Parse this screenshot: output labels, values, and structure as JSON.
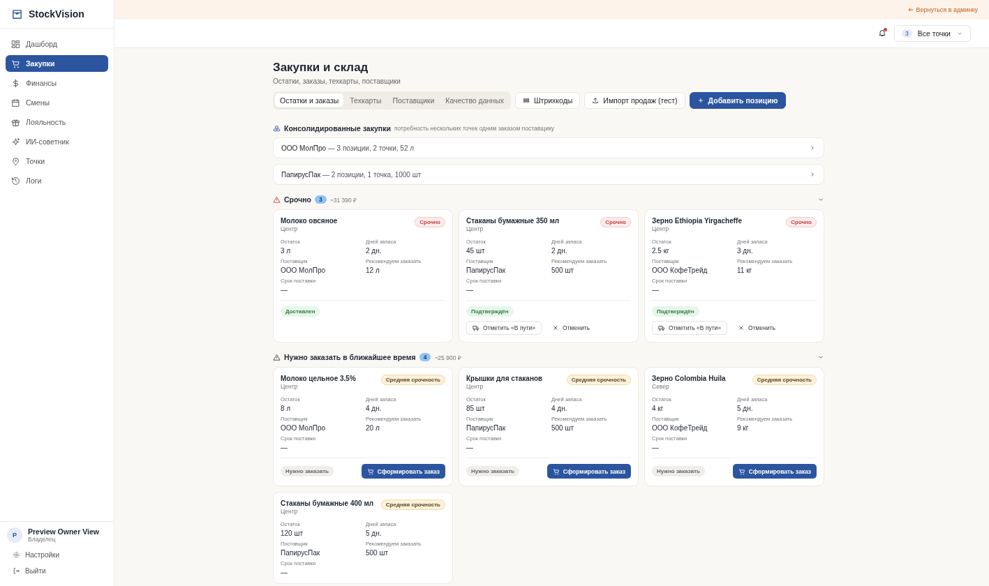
{
  "sidebar": {
    "brand": "StockVision",
    "items": [
      {
        "label": "Дашборд",
        "selected": false
      },
      {
        "label": "Закупки",
        "selected": true
      },
      {
        "label": "Финансы",
        "selected": false
      },
      {
        "label": "Смены",
        "selected": false
      },
      {
        "label": "Лояльность",
        "selected": false
      },
      {
        "label": "ИИ-советник",
        "selected": false
      },
      {
        "label": "Точки",
        "selected": false
      },
      {
        "label": "Логи",
        "selected": false
      }
    ],
    "user": {
      "initial": "P",
      "name": "Preview Owner View",
      "role": "Владелец"
    },
    "footer_links": [
      "Настройки",
      "Выйти"
    ]
  },
  "banner": {
    "link": "Вернуться в админку"
  },
  "header": {
    "notifications_unread": true,
    "location_count": "3",
    "location_label": "Все точки"
  },
  "page": {
    "title": "Закупки и склад",
    "subtitle": "Остатки, заказы, техкарты, поставщики",
    "tabs": [
      {
        "label": "Остатки и заказы",
        "selected": true
      },
      {
        "label": "Техкарты",
        "selected": false
      },
      {
        "label": "Поставщики",
        "selected": false
      },
      {
        "label": "Качество данных",
        "selected": false
      }
    ],
    "buttons": [
      {
        "label": "Штрихкоды",
        "kind": "barcode"
      },
      {
        "label": "Импорт продаж (тест)",
        "kind": "upload"
      },
      {
        "label": "Добавить позицию",
        "kind": "add"
      }
    ]
  },
  "consolidated": {
    "title": "Консолидированные закупки",
    "hint": "потребность нескольких точек одним заказом поставщику",
    "rows": [
      {
        "supplier": "ООО МолПро",
        "details": "— 3 позиции, 2 точки, 52 л"
      },
      {
        "supplier": "ПапирусПак",
        "details": "— 2 позиции, 1 точка, 1000 шт"
      }
    ]
  },
  "sections": [
    {
      "kind": "urgent",
      "title": "Срочно",
      "count": "3",
      "total": "~31 390 ₽",
      "expanded": true,
      "cards": [
        {
          "name": "Молоко овсяное",
          "location": "Центр",
          "badge": {
            "text": "Срочно",
            "kind": "urgent"
          },
          "fields": [
            {
              "label": "Остаток",
              "value": "3 л"
            },
            {
              "label": "Дней запаса",
              "value": "2 дн."
            },
            {
              "label": "Поставщик",
              "value": "ООО МолПро"
            },
            {
              "label": "Рекомендуем заказать",
              "value": "12 л"
            },
            {
              "label": "Срок поставки",
              "value": "—"
            }
          ],
          "status": {
            "text": "Доставлен",
            "kind": "done"
          }
        },
        {
          "name": "Стаканы бумажные 350 мл",
          "location": "Центр",
          "badge": {
            "text": "Срочно",
            "kind": "urgent"
          },
          "fields": [
            {
              "label": "Остаток",
              "value": "45 шт"
            },
            {
              "label": "Дней запаса",
              "value": "2 дн."
            },
            {
              "label": "Поставщик",
              "value": "ПапирусПак"
            },
            {
              "label": "Рекомендуем заказать",
              "value": "500 шт"
            },
            {
              "label": "Срок поставки",
              "value": "—"
            }
          ],
          "status": {
            "text": "Подтверждён",
            "kind": "done"
          },
          "actions": [
            {
              "label": "Отметить «В пути»",
              "kind": "ship"
            },
            {
              "label": "Отменить",
              "kind": "cancel"
            }
          ]
        },
        {
          "name": "Зерно Ethiopia Yirgacheffe",
          "location": "Центр",
          "badge": {
            "text": "Срочно",
            "kind": "urgent"
          },
          "fields": [
            {
              "label": "Остаток",
              "value": "2.5 кг"
            },
            {
              "label": "Дней запаса",
              "value": "3 дн."
            },
            {
              "label": "Поставщик",
              "value": "ООО КофеТрейд"
            },
            {
              "label": "Рекомендуем заказать",
              "value": "11 кг"
            },
            {
              "label": "Срок поставки",
              "value": "—"
            }
          ],
          "status": {
            "text": "Подтверждён",
            "kind": "done"
          },
          "actions": [
            {
              "label": "Отметить «В пути»",
              "kind": "ship"
            },
            {
              "label": "Отменить",
              "kind": "cancel"
            }
          ]
        }
      ]
    },
    {
      "kind": "soon",
      "title": "Нужно заказать в ближайшее время",
      "count": "4",
      "total": "~25 900 ₽",
      "expanded": true,
      "cards": [
        {
          "name": "Молоко цельное 3.5%",
          "location": "Центр",
          "badge": {
            "text": "Средняя срочность",
            "kind": "medium"
          },
          "fields": [
            {
              "label": "Остаток",
              "value": "8 л"
            },
            {
              "label": "Дней запаса",
              "value": "4 дн."
            },
            {
              "label": "Поставщик",
              "value": "ООО МолПро"
            },
            {
              "label": "Рекомендуем заказать",
              "value": "20 л"
            },
            {
              "label": "Срок поставки",
              "value": "—"
            }
          ],
          "status": {
            "text": "Нужно заказать",
            "kind": "todo"
          },
          "actions": [
            {
              "label": "Сформировать заказ",
              "kind": "order"
            }
          ]
        },
        {
          "name": "Крышки для стаканов",
          "location": "Центр",
          "badge": {
            "text": "Средняя срочность",
            "kind": "medium"
          },
          "fields": [
            {
              "label": "Остаток",
              "value": "85 шт"
            },
            {
              "label": "Дней запаса",
              "value": "4 дн."
            },
            {
              "label": "Поставщик",
              "value": "ПапирусПак"
            },
            {
              "label": "Рекомендуем заказать",
              "value": "500 шт"
            },
            {
              "label": "Срок поставки",
              "value": "—"
            }
          ],
          "status": {
            "text": "Нужно заказать",
            "kind": "todo"
          },
          "actions": [
            {
              "label": "Сформировать заказ",
              "kind": "order"
            }
          ]
        },
        {
          "name": "Зерно Colombia Huila",
          "location": "Север",
          "badge": {
            "text": "Средняя срочность",
            "kind": "medium"
          },
          "fields": [
            {
              "label": "Остаток",
              "value": "4 кг"
            },
            {
              "label": "Дней запаса",
              "value": "5 дн."
            },
            {
              "label": "Поставщик",
              "value": "ООО КофеТрейд"
            },
            {
              "label": "Рекомендуем заказать",
              "value": "9 кг"
            },
            {
              "label": "Срок поставки",
              "value": "—"
            }
          ],
          "status": {
            "text": "Нужно заказать",
            "kind": "todo"
          },
          "actions": [
            {
              "label": "Сформировать заказ",
              "kind": "order"
            }
          ]
        },
        {
          "name": "Стаканы бумажные 400 мл",
          "location": "Центр",
          "badge": {
            "text": "Средняя срочность",
            "kind": "medium"
          },
          "fields": [
            {
              "label": "Остаток",
              "value": "120 шт"
            },
            {
              "label": "Дней запаса",
              "value": "5 дн."
            },
            {
              "label": "Поставщик",
              "value": "ПапирусПак"
            },
            {
              "label": "Рекомендуем заказать",
              "value": "500 шт"
            },
            {
              "label": "Срок поставки",
              "value": "—"
            }
          ]
        }
      ]
    }
  ]
}
